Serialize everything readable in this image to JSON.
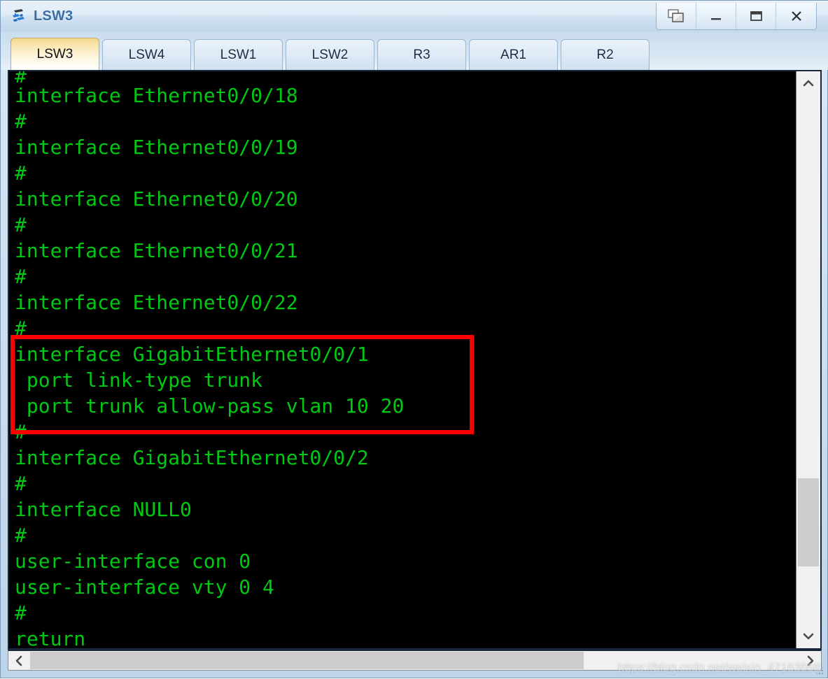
{
  "window": {
    "title": "LSW3",
    "icon": "switch-device-icon",
    "controls": [
      {
        "name": "restore-cascade-button",
        "label": "Restore"
      },
      {
        "name": "minimize-button",
        "label": "Minimize"
      },
      {
        "name": "maximize-button",
        "label": "Maximize"
      },
      {
        "name": "close-button",
        "label": "X"
      }
    ]
  },
  "tabs": [
    {
      "label": "LSW3",
      "active": true
    },
    {
      "label": "LSW4",
      "active": false
    },
    {
      "label": "LSW1",
      "active": false
    },
    {
      "label": "LSW2",
      "active": false
    },
    {
      "label": "R3",
      "active": false
    },
    {
      "label": "AR1",
      "active": false
    },
    {
      "label": "R2",
      "active": false
    }
  ],
  "terminal": {
    "foreground_color": "#00c813",
    "background_color": "#000000",
    "lines": [
      "#",
      "interface Ethernet0/0/18",
      "#",
      "interface Ethernet0/0/19",
      "#",
      "interface Ethernet0/0/20",
      "#",
      "interface Ethernet0/0/21",
      "#",
      "interface Ethernet0/0/22",
      "#",
      "interface GigabitEthernet0/0/1",
      " port link-type trunk",
      " port trunk allow-pass vlan 10 20",
      "#",
      "interface GigabitEthernet0/0/2",
      "#",
      "interface NULL0",
      "#",
      "user-interface con 0",
      "user-interface vty 0 4",
      "#",
      "return"
    ],
    "highlight": {
      "color": "#ff0000",
      "start_line_index": 11,
      "end_line_index": 13,
      "lines": [
        "interface GigabitEthernet0/0/1",
        " port link-type trunk",
        " port trunk allow-pass vlan 10 20"
      ]
    }
  },
  "scrollbars": {
    "vertical": {
      "up_arrow": "chevron-up-icon",
      "down_arrow": "chevron-down-icon"
    },
    "horizontal": {
      "left_arrow": "chevron-left-icon",
      "right_arrow": "chevron-right-icon"
    }
  },
  "watermark": "https://blog.csdn.net/weixin_47163668"
}
